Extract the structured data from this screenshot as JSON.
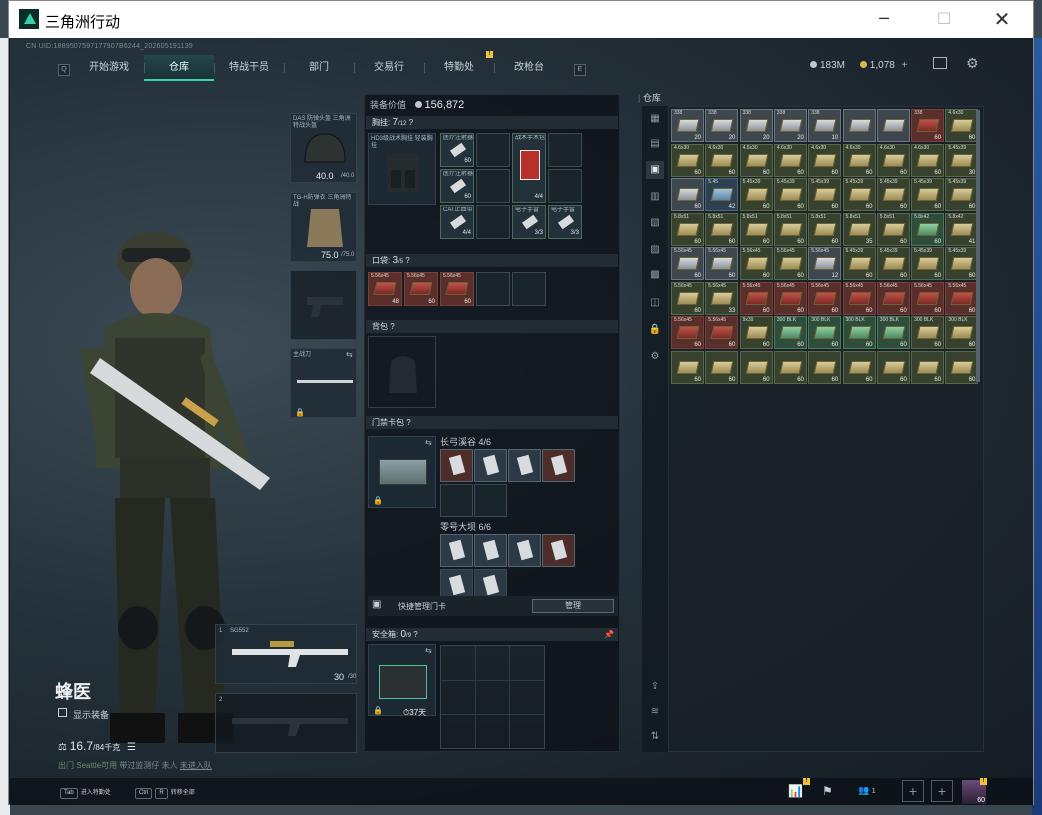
{
  "window": {
    "title": "三角洲行动",
    "minimize_icon": "minimize-icon",
    "maximize_icon": "maximize-icon",
    "close_icon": "close-icon"
  },
  "uid_text": "CN UID:1889507597177907B6244_202605191139",
  "nav": {
    "left_key": "Q",
    "right_key": "E",
    "items": [
      "开始游戏",
      "仓库",
      "特战干员",
      "部门",
      "交易行",
      "特勤处",
      "改枪台"
    ],
    "active": "仓库"
  },
  "currency": {
    "silver": "183M",
    "gold": "1,078",
    "plus": "+"
  },
  "equip_slots": {
    "helmet": {
      "name": "DAS 防弹头盔 三角洲特战头盔",
      "durability": "40.0",
      "max": "/40.0"
    },
    "armor": {
      "name": "TG-H防弹衣 三角洲特战",
      "durability": "75.0",
      "max": "/75.0"
    },
    "melee": {
      "name": "主战刀"
    },
    "primary": {
      "name": "SG552",
      "key": "1",
      "ammo": "30",
      "ammo_max": "/30"
    },
    "secondary": {
      "key": "2"
    }
  },
  "character": {
    "name": "蜂医",
    "show_equip": "显示装备",
    "weight": "16.7",
    "weight_max": "/84千克",
    "status_1": "出门",
    "status_2": "Seattle可用",
    "status_3": "带过监测仔",
    "status_4": "未人",
    "status_5": "未进入队"
  },
  "equip_value": {
    "label": "装备价值",
    "value": "156,872"
  },
  "rig": {
    "label": "胸挂:",
    "count": "7",
    "max": "/12",
    "item": "HD3级战术胸挂 轻装胸挂"
  },
  "rig_items": [
    {
      "name": "医疗注射器",
      "count": "60"
    },
    {
      "name": "医疗注射器",
      "count": "60"
    },
    {
      "name": "CAT止血带",
      "count": "4/4"
    },
    {
      "name": "战术手术包",
      "count": "4/4"
    },
    {
      "name": "电子手雷",
      "count": "3/3"
    },
    {
      "name": "电子手雷",
      "count": "3/3"
    }
  ],
  "pocket": {
    "label": "口袋:",
    "count": "3",
    "max": "/5",
    "items": [
      {
        "name": "5.56x45",
        "count": "48"
      },
      {
        "name": "5.56x45",
        "count": "60"
      },
      {
        "name": "5.56x45",
        "count": "60"
      }
    ]
  },
  "backpack": {
    "label": "背包"
  },
  "keycard": {
    "label": "门禁卡包",
    "area_1": {
      "name": "长弓溪谷",
      "count": "4/6"
    },
    "area_2": {
      "name": "零号大坝",
      "count": "6/6"
    },
    "quick_manage": "快捷管理门卡",
    "manage_btn": "管理"
  },
  "safebox": {
    "label": "安全箱:",
    "count": "0",
    "max": "/9",
    "timer": "37天"
  },
  "warehouse": {
    "title": "仓库",
    "items": [
      {
        "n": "338",
        "c": "20",
        "t": "gray"
      },
      {
        "n": "338",
        "c": "20",
        "t": "gray"
      },
      {
        "n": "338",
        "c": "20",
        "t": "gray"
      },
      {
        "n": "338",
        "c": "20",
        "t": "gray"
      },
      {
        "n": "338",
        "c": "10",
        "t": "gray"
      },
      {
        "n": "",
        "c": "",
        "t": "gray"
      },
      {
        "n": "",
        "c": "",
        "t": "gray"
      },
      {
        "n": "338",
        "c": "60",
        "t": "red"
      },
      {
        "n": "4.6x30",
        "c": "60",
        "t": "tan"
      },
      {
        "n": "4.6x30",
        "c": "60",
        "t": "tan"
      },
      {
        "n": "4.6x30",
        "c": "60",
        "t": "tan"
      },
      {
        "n": "4.6x30",
        "c": "60",
        "t": "tan"
      },
      {
        "n": "4.6x30",
        "c": "60",
        "t": "tan"
      },
      {
        "n": "4.6x30",
        "c": "60",
        "t": "tan"
      },
      {
        "n": "4.6x30",
        "c": "60",
        "t": "tan"
      },
      {
        "n": "4.6x30",
        "c": "60",
        "t": "tan"
      },
      {
        "n": "4.6x30",
        "c": "60",
        "t": "tan"
      },
      {
        "n": "5.45x39",
        "c": "30",
        "t": "tan"
      },
      {
        "n": "",
        "c": "60",
        "t": "gray"
      },
      {
        "n": "5.45",
        "c": "42",
        "t": "blue"
      },
      {
        "n": "5.45x39",
        "c": "60",
        "t": "tan"
      },
      {
        "n": "5.45x39",
        "c": "60",
        "t": "tan"
      },
      {
        "n": "5.45x39",
        "c": "60",
        "t": "tan"
      },
      {
        "n": "5.45x39",
        "c": "60",
        "t": "tan"
      },
      {
        "n": "5.45x39",
        "c": "60",
        "t": "tan"
      },
      {
        "n": "5.45x39",
        "c": "60",
        "t": "tan"
      },
      {
        "n": "5.45x39",
        "c": "60",
        "t": "tan"
      },
      {
        "n": "5.8x51",
        "c": "60",
        "t": "tan"
      },
      {
        "n": "5.8x51",
        "c": "60",
        "t": "tan"
      },
      {
        "n": "5.8x51",
        "c": "60",
        "t": "tan"
      },
      {
        "n": "5.8x51",
        "c": "60",
        "t": "tan"
      },
      {
        "n": "5.8x51",
        "c": "60",
        "t": "tan"
      },
      {
        "n": "5.8x51",
        "c": "35",
        "t": "tan"
      },
      {
        "n": "5.8x51",
        "c": "60",
        "t": "tan"
      },
      {
        "n": "5.8x42",
        "c": "60",
        "t": "green"
      },
      {
        "n": "5.8x42",
        "c": "41",
        "t": "tan"
      },
      {
        "n": "5.56x45",
        "c": "60",
        "t": "gray"
      },
      {
        "n": "5.56x45",
        "c": "60",
        "t": "gray"
      },
      {
        "n": "5.56x45",
        "c": "60",
        "t": "tan"
      },
      {
        "n": "5.56x45",
        "c": "60",
        "t": "tan"
      },
      {
        "n": "5.56x45",
        "c": "12",
        "t": "gray"
      },
      {
        "n": "5.45x39",
        "c": "60",
        "t": "tan"
      },
      {
        "n": "5.45x39",
        "c": "60",
        "t": "tan"
      },
      {
        "n": "5.45x39",
        "c": "60",
        "t": "tan"
      },
      {
        "n": "5.45x39",
        "c": "60",
        "t": "tan"
      },
      {
        "n": "5.56x45",
        "c": "60",
        "t": "tan"
      },
      {
        "n": "5.56x45",
        "c": "33",
        "t": "tan"
      },
      {
        "n": "5.56x45",
        "c": "60",
        "t": "red"
      },
      {
        "n": "5.56x45",
        "c": "60",
        "t": "red"
      },
      {
        "n": "5.56x45",
        "c": "60",
        "t": "red"
      },
      {
        "n": "5.56x45",
        "c": "60",
        "t": "red"
      },
      {
        "n": "5.56x45",
        "c": "60",
        "t": "red"
      },
      {
        "n": "5.56x45",
        "c": "60",
        "t": "red"
      },
      {
        "n": "5.56x45",
        "c": "60",
        "t": "red"
      },
      {
        "n": "5.56x45",
        "c": "60",
        "t": "red"
      },
      {
        "n": "5.56x45",
        "c": "60",
        "t": "red"
      },
      {
        "n": "9x39",
        "c": "60",
        "t": "tan"
      },
      {
        "n": "300 BLK",
        "c": "60",
        "t": "green"
      },
      {
        "n": "300 BLK",
        "c": "60",
        "t": "green"
      },
      {
        "n": "300 BLK",
        "c": "60",
        "t": "green"
      },
      {
        "n": "300 BLK",
        "c": "60",
        "t": "green"
      },
      {
        "n": "300 BLK",
        "c": "60",
        "t": "tan"
      },
      {
        "n": "300 BLK",
        "c": "60",
        "t": "tan"
      },
      {
        "n": "",
        "c": "60",
        "t": "tan"
      },
      {
        "n": "",
        "c": "60",
        "t": "tan"
      },
      {
        "n": "",
        "c": "60",
        "t": "tan"
      },
      {
        "n": "",
        "c": "60",
        "t": "tan"
      },
      {
        "n": "",
        "c": "60",
        "t": "tan"
      },
      {
        "n": "",
        "c": "60",
        "t": "tan"
      },
      {
        "n": "",
        "c": "60",
        "t": "tan"
      },
      {
        "n": "",
        "c": "60",
        "t": "tan"
      },
      {
        "n": "",
        "c": "60",
        "t": "tan"
      }
    ]
  },
  "bottom": {
    "tab_key": "Tab",
    "tab_label": "进入特勤处",
    "ctrl_key": "Ctrl",
    "ctrl_key2": "R",
    "ctrl_label": "转移全部",
    "party_count": "1",
    "level": "60",
    "plus": "+"
  },
  "colors": {
    "accent": "#38d4b0",
    "notify": "#f2c23a",
    "bg": "#111820"
  }
}
